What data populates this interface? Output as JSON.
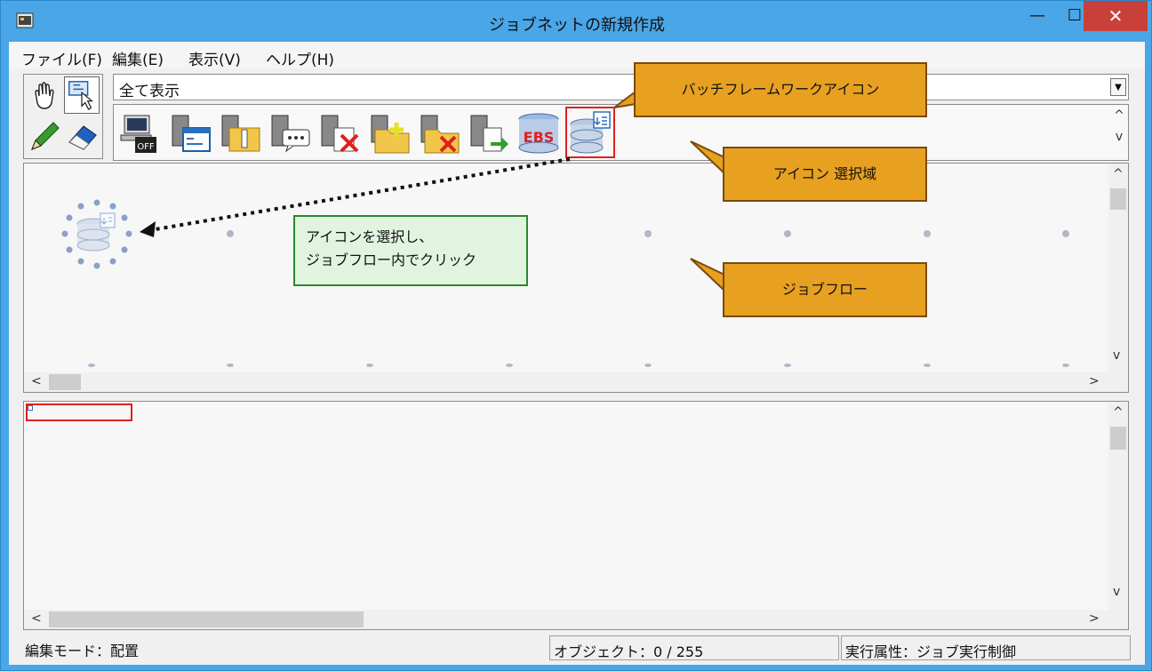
{
  "window": {
    "title": "ジョブネットの新規作成",
    "minimize": "—",
    "maximize": "☐",
    "close": "✕"
  },
  "menu": [
    {
      "label": "ファイル(F)"
    },
    {
      "label": "編集(E)"
    },
    {
      "label": "表示(V)"
    },
    {
      "label": "ヘルプ(H)"
    }
  ],
  "filter": {
    "value": "全て表示",
    "arrow": "▼"
  },
  "palette": {
    "icons": [
      {
        "name": "job-off-icon"
      },
      {
        "name": "server-window-icon"
      },
      {
        "name": "server-zip-icon"
      },
      {
        "name": "server-message-icon"
      },
      {
        "name": "server-delete-icon"
      },
      {
        "name": "folder-add-icon"
      },
      {
        "name": "folder-delete-icon"
      },
      {
        "name": "server-transfer-icon"
      },
      {
        "name": "ebs-icon",
        "text": "EBS"
      },
      {
        "name": "batch-framework-icon"
      }
    ],
    "scroll_up": "^",
    "scroll_down": "v"
  },
  "scroll": {
    "up": "^",
    "down": "v",
    "left": "<",
    "right": ">"
  },
  "status": {
    "mode": "編集モード：配置",
    "objects": "オブジェクト：0 / 255",
    "attr": "実行属性：ジョブ実行制御"
  },
  "annotations": {
    "batch_framework_icon": "バッチフレームワークアイコン",
    "icon_area": "アイコン 選択域",
    "job_flow": "ジョブフロー",
    "instruction_line1": "アイコンを選択し、",
    "instruction_line2": "ジョブフロー内でクリック"
  },
  "colors": {
    "callout": "#e8a020",
    "note": "#e0f4e0",
    "highlight": "#e02020",
    "titlebar": "#4aa6e6"
  }
}
